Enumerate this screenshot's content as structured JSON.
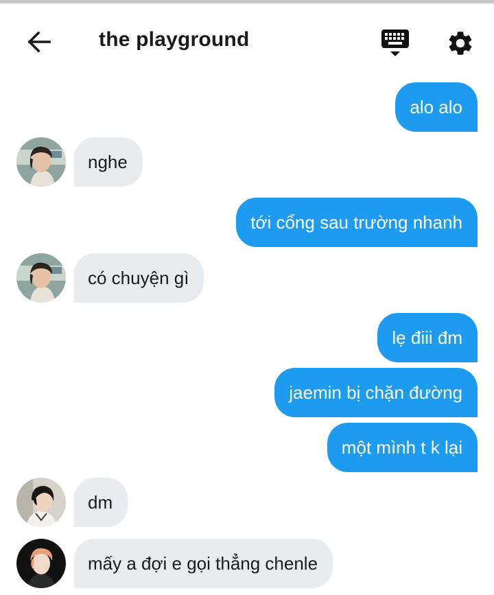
{
  "header": {
    "title": "the playground",
    "back_icon": "arrow-left-icon",
    "keyboard_icon": "keyboard-icon",
    "settings_icon": "gear-icon"
  },
  "messages": [
    {
      "sender": "me",
      "text": "alo alo"
    },
    {
      "sender": "friend-a",
      "text": "nghe"
    },
    {
      "sender": "me",
      "text": "tới cổng sau trường nhanh"
    },
    {
      "sender": "friend-a",
      "text": "có chuyện gì"
    },
    {
      "sender": "me",
      "text": "lẹ điii đm"
    },
    {
      "sender": "me",
      "text": "jaemin bị chặn đường"
    },
    {
      "sender": "me",
      "text": "một mình t k lại"
    },
    {
      "sender": "friend-b",
      "text": "dm"
    },
    {
      "sender": "friend-c",
      "text": "mấy a đợi e gọi thẳng chenle"
    }
  ],
  "colors": {
    "outgoing_bubble": "#1d9bf0",
    "incoming_bubble": "#e9ecef",
    "text_dark": "#1a1a1a"
  }
}
